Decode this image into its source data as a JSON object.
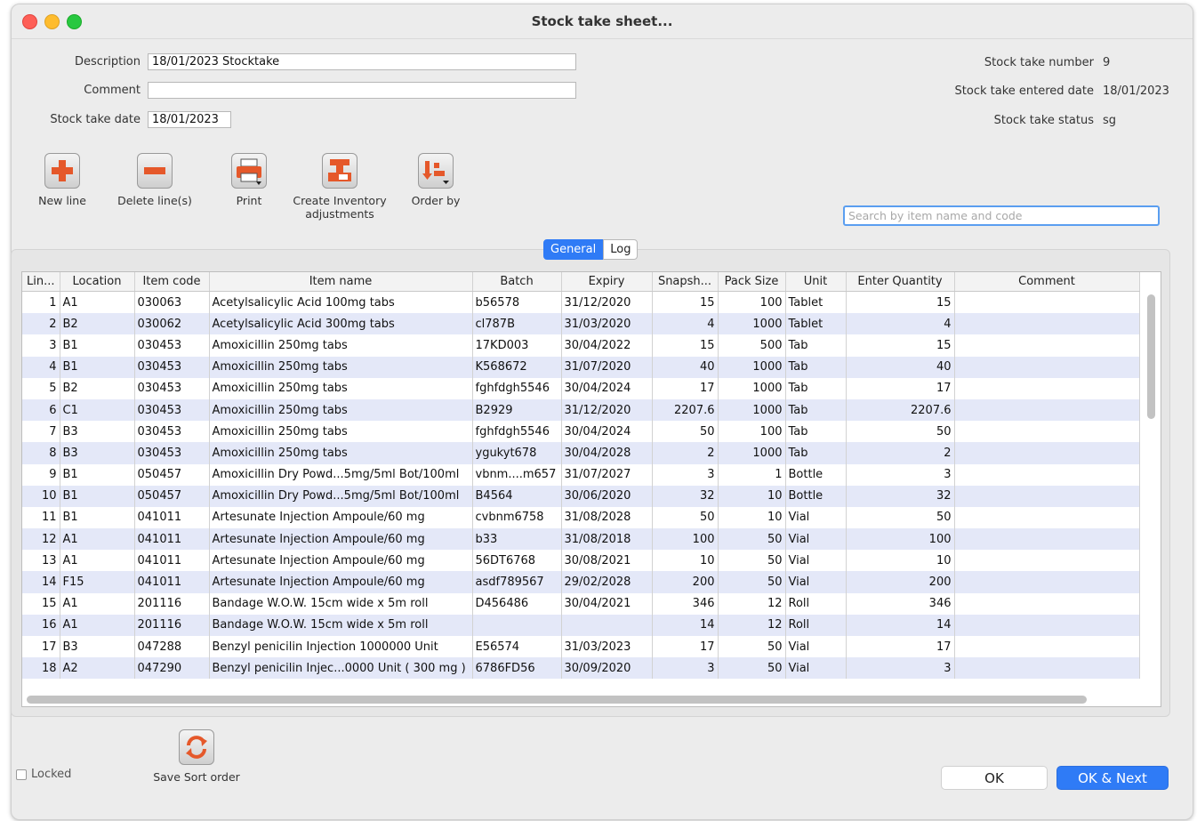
{
  "window": {
    "title": "Stock take sheet..."
  },
  "form": {
    "description_label": "Description",
    "description_value": "18/01/2023 Stocktake",
    "comment_label": "Comment",
    "comment_value": "",
    "date_label": "Stock take date",
    "date_value": "18/01/2023"
  },
  "info": {
    "number_label": "Stock take number",
    "number_value": "9",
    "entered_label": "Stock take entered date",
    "entered_value": "18/01/2023",
    "status_label": "Stock take status",
    "status_value": "sg"
  },
  "toolbar": {
    "new_line": "New line",
    "delete_lines": "Delete line(s)",
    "print": "Print",
    "create_adj_1": "Create Inventory",
    "create_adj_2": "adjustments",
    "order_by": "Order by"
  },
  "search": {
    "placeholder": "Search by item name and code"
  },
  "tabs": {
    "general": "General",
    "log": "Log"
  },
  "columns": [
    "Lin...",
    "Location",
    "Item code",
    "Item name",
    "Batch",
    "Expiry",
    "Snapsh...",
    "Pack Size",
    "Unit",
    "Enter Quantity",
    "Comment"
  ],
  "rows": [
    [
      "1",
      "A1",
      "030063",
      "Acetylsalicylic Acid 100mg tabs",
      "b56578",
      "31/12/2020",
      "15",
      "100",
      "Tablet",
      "15",
      ""
    ],
    [
      "2",
      "B2",
      "030062",
      "Acetylsalicylic Acid 300mg tabs",
      "cl787B",
      "31/03/2020",
      "4",
      "1000",
      "Tablet",
      "4",
      ""
    ],
    [
      "3",
      "B1",
      "030453",
      "Amoxicillin 250mg tabs",
      "17KD003",
      "30/04/2022",
      "15",
      "500",
      "Tab",
      "15",
      ""
    ],
    [
      "4",
      "B1",
      "030453",
      "Amoxicillin 250mg tabs",
      "K568672",
      "31/07/2020",
      "40",
      "1000",
      "Tab",
      "40",
      ""
    ],
    [
      "5",
      "B2",
      "030453",
      "Amoxicillin 250mg tabs",
      "fghfdgh5546",
      "30/04/2024",
      "17",
      "1000",
      "Tab",
      "17",
      ""
    ],
    [
      "6",
      "C1",
      "030453",
      "Amoxicillin 250mg tabs",
      "B2929",
      "31/12/2020",
      "2207.6",
      "1000",
      "Tab",
      "2207.6",
      ""
    ],
    [
      "7",
      "B3",
      "030453",
      "Amoxicillin 250mg tabs",
      "fghfdgh5546",
      "30/04/2024",
      "50",
      "100",
      "Tab",
      "50",
      ""
    ],
    [
      "8",
      "B3",
      "030453",
      "Amoxicillin 250mg tabs",
      "ygukyt678",
      "30/04/2028",
      "2",
      "1000",
      "Tab",
      "2",
      ""
    ],
    [
      "9",
      "B1",
      "050457",
      "Amoxicillin Dry Powd...5mg/5ml Bot/100ml",
      "vbnm....m657",
      "31/07/2027",
      "3",
      "1",
      "Bottle",
      "3",
      ""
    ],
    [
      "10",
      "B1",
      "050457",
      "Amoxicillin Dry Powd...5mg/5ml Bot/100ml",
      "B4564",
      "30/06/2020",
      "32",
      "10",
      "Bottle",
      "32",
      ""
    ],
    [
      "11",
      "B1",
      "041011",
      "Artesunate Injection Ampoule/60 mg",
      "cvbnm6758",
      "31/08/2028",
      "50",
      "10",
      "Vial",
      "50",
      ""
    ],
    [
      "12",
      "A1",
      "041011",
      "Artesunate Injection Ampoule/60 mg",
      "b33",
      "31/08/2018",
      "100",
      "50",
      "Vial",
      "100",
      ""
    ],
    [
      "13",
      "A1",
      "041011",
      "Artesunate Injection Ampoule/60 mg",
      "56DT6768",
      "30/08/2021",
      "10",
      "50",
      "Vial",
      "10",
      ""
    ],
    [
      "14",
      "F15",
      "041011",
      "Artesunate Injection Ampoule/60 mg",
      "asdf789567",
      "29/02/2028",
      "200",
      "50",
      "Vial",
      "200",
      ""
    ],
    [
      "15",
      "A1",
      "201116",
      "Bandage W.O.W. 15cm wide x 5m roll",
      "D456486",
      "30/04/2021",
      "346",
      "12",
      "Roll",
      "346",
      ""
    ],
    [
      "16",
      "A1",
      "201116",
      "Bandage W.O.W. 15cm wide x 5m roll",
      "",
      "",
      "14",
      "12",
      "Roll",
      "14",
      ""
    ],
    [
      "17",
      "B3",
      "047288",
      "Benzyl penicilin Injection 1000000 Unit",
      "E56574",
      "31/03/2023",
      "17",
      "50",
      "Vial",
      "17",
      ""
    ],
    [
      "18",
      "A2",
      "047290",
      "Benzyl penicilin Injec...0000 Unit ( 300 mg )",
      "6786FD56",
      "30/09/2020",
      "3",
      "50",
      "Vial",
      "3",
      ""
    ]
  ],
  "footer": {
    "locked": "Locked",
    "save_sort": "Save Sort order",
    "ok": "OK",
    "ok_next": "OK & Next"
  },
  "colors": {
    "accent": "#2f7bf6",
    "row_alt": "#e4e8f8",
    "icon_orange": "#e5582a"
  }
}
